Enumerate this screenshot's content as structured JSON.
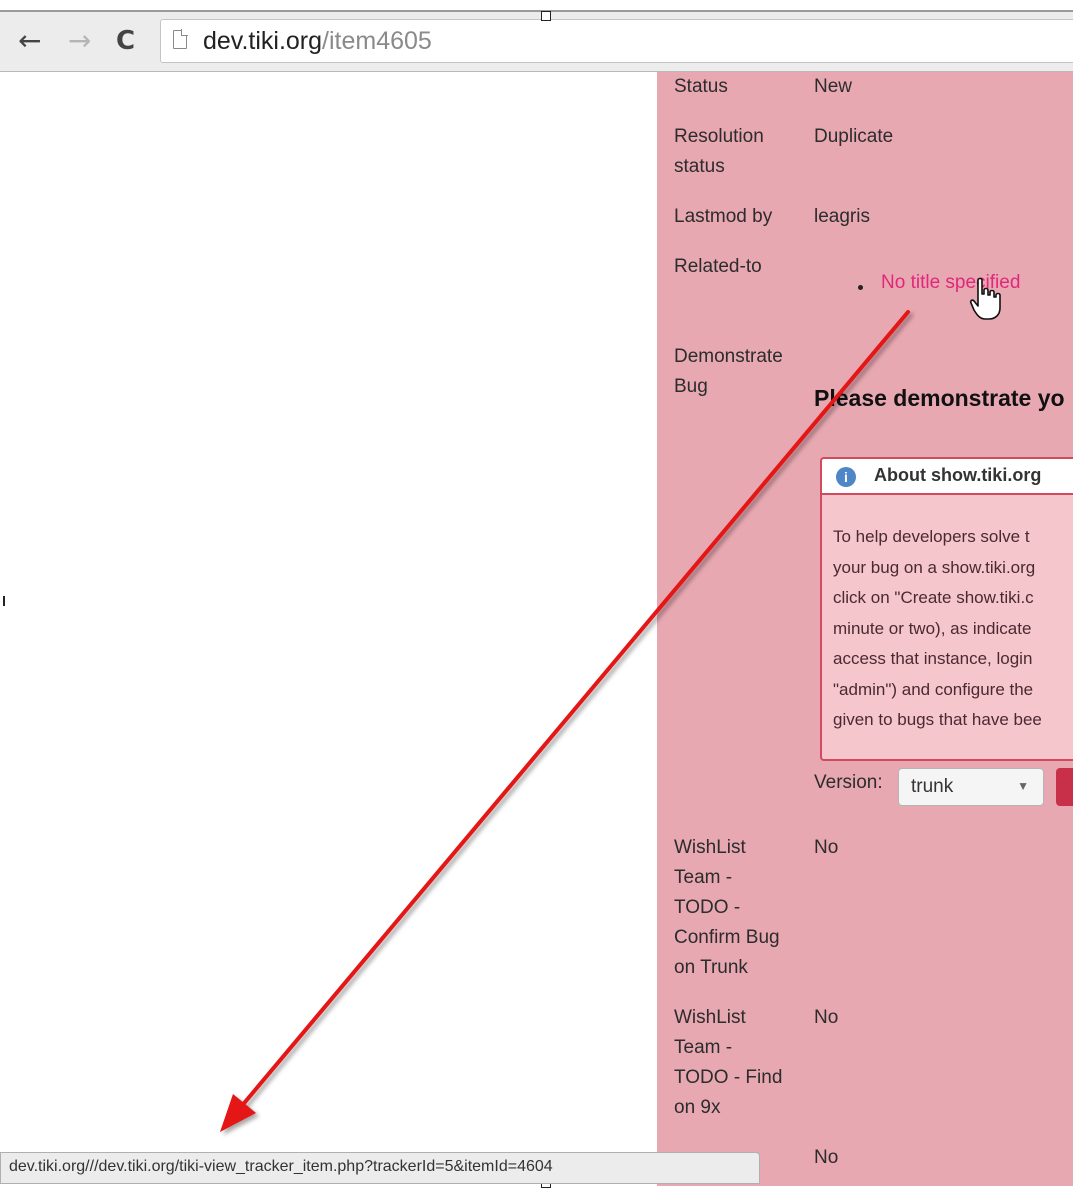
{
  "browser": {
    "url_host": "dev.tiki.org",
    "url_path": "/item4605",
    "back_icon": "←",
    "forward_icon": "→",
    "reload_icon": "C",
    "status_url": "dev.tiki.org///dev.tiki.org/tiki-view_tracker_item.php?trackerId=5&itemId=4604"
  },
  "fields": [
    {
      "label": "Status",
      "value": "New"
    },
    {
      "label_lines": [
        "Resolution",
        "status"
      ],
      "value": "Duplicate"
    },
    {
      "label": "Lastmod by",
      "value": "leagris"
    },
    {
      "label": "Related-to",
      "link": "No title specified"
    },
    {
      "label_lines": [
        "Demonstrate",
        "Bug"
      ],
      "heading": "Please demonstrate yo"
    },
    {
      "label_lines": [
        "WishList",
        "Team -",
        "TODO -",
        "Confirm Bug",
        "on Trunk"
      ],
      "value": "No"
    },
    {
      "label_lines": [
        "WishList",
        "Team -",
        "TODO - Find",
        "on 9x"
      ],
      "value": "No"
    },
    {
      "value": "No"
    }
  ],
  "show_box": {
    "title": "About show.tiki.org",
    "body_lines": [
      "To help developers solve t",
      "your bug on a show.tiki.org",
      "click on \"Create show.tiki.c",
      "minute or two), as indicate",
      "access that instance, login",
      "\"admin\") and configure the",
      "given to bugs that have bee"
    ]
  },
  "version": {
    "label": "Version:",
    "selected": "trunk"
  },
  "colors": {
    "panel": "#e8a8b2",
    "link": "#e0287a",
    "arrow": "#e41414",
    "box_border": "#d24a5e"
  },
  "icons": [
    "back-arrow-icon",
    "forward-arrow-icon",
    "reload-icon",
    "page-icon",
    "info-icon",
    "hand-cursor-icon",
    "chevron-down-icon"
  ]
}
